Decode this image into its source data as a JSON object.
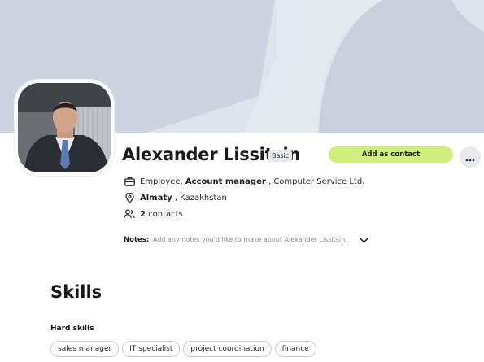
{
  "profile": {
    "name": "Alexander Lissitsin",
    "plan_badge": "Basic",
    "job_type": "Employee,",
    "job_title": "Account manager",
    "job_company": ", Computer Service Ltd.",
    "city": "Almaty",
    "country": ", Kazakhstan",
    "contacts_count": "2",
    "contacts_label": "contacts"
  },
  "actions": {
    "add_contact_label": "Add as contact",
    "more_icon": "more-horizontal-icon"
  },
  "notes": {
    "label": "Notes:",
    "placeholder": "Add any notes you'd like to make about Alexander Lissitsin."
  },
  "skills": {
    "title": "Skills",
    "hard_label": "Hard skills",
    "hard": [
      "sales manager",
      "IT specialist",
      "project coordination",
      "finance"
    ]
  },
  "icons": {
    "job": "briefcase-icon",
    "location": "location-pin-icon",
    "contacts": "users-icon",
    "notes_toggle": "chevron-down-icon"
  },
  "colors": {
    "cover": "#dde2ea",
    "accent_button": "#cfee7b"
  }
}
